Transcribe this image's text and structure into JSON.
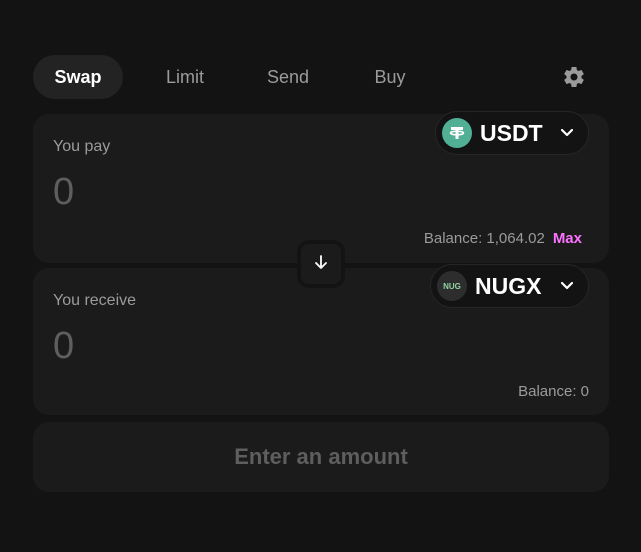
{
  "tabs": [
    {
      "label": "Swap",
      "active": true
    },
    {
      "label": "Limit",
      "active": false
    },
    {
      "label": "Send",
      "active": false
    },
    {
      "label": "Buy",
      "active": false
    }
  ],
  "settings_icon": "gear-icon",
  "pay": {
    "label": "You pay",
    "amount_placeholder": "0",
    "token": {
      "symbol": "USDT",
      "icon": "usdt-logo",
      "color": "#50af95"
    },
    "balance": "Balance: 1,064.02",
    "max_label": "Max"
  },
  "switch_icon": "arrow-down-icon",
  "receive": {
    "label": "You receive",
    "amount_placeholder": "0",
    "token": {
      "symbol": "NUGX",
      "icon_text": "NUG",
      "icon": "nugx-logo"
    },
    "balance": "Balance: 0"
  },
  "cta_label": "Enter an amount",
  "colors": {
    "background": "#131313",
    "panel": "#1b1b1b",
    "accent": "#fc72ff",
    "muted": "#9b9b9b"
  }
}
